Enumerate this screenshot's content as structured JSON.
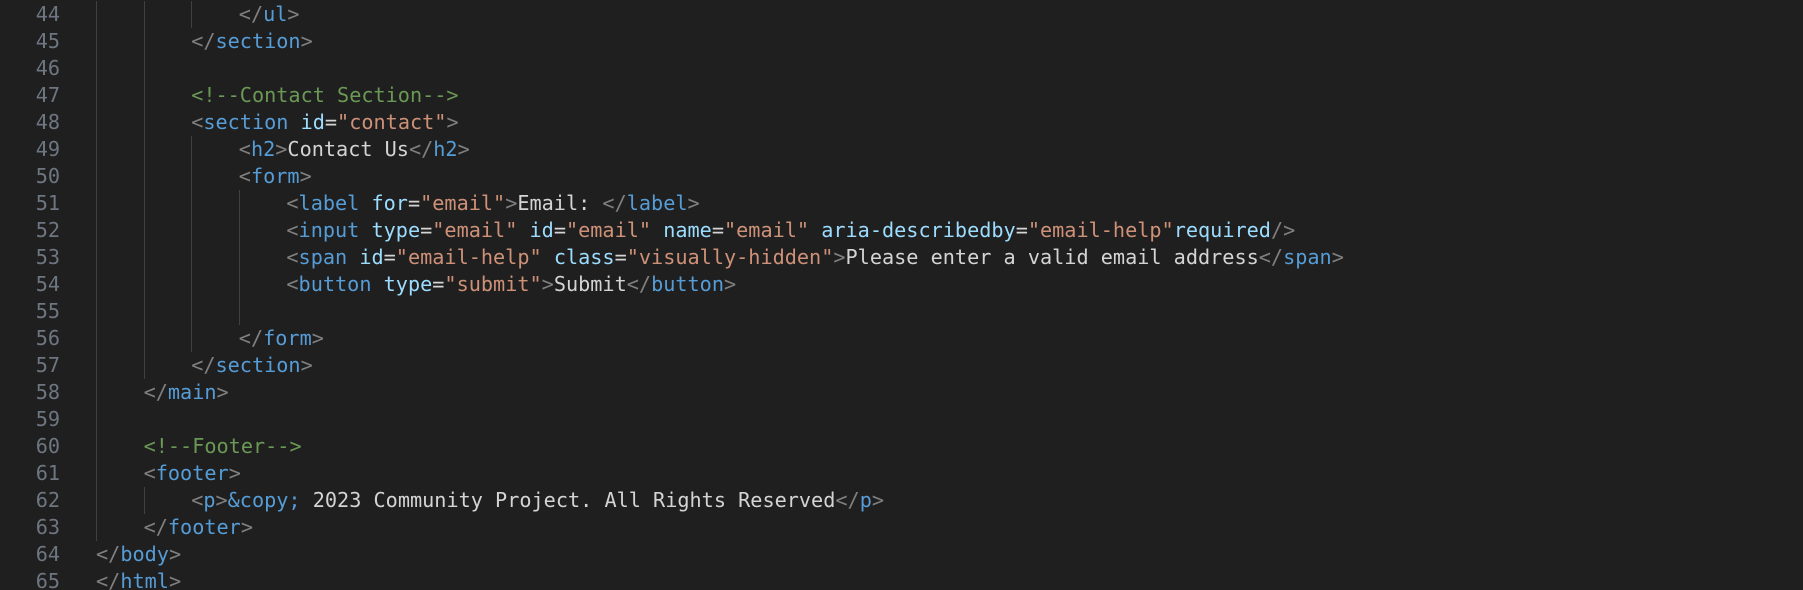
{
  "editor": {
    "language": "html",
    "colors": {
      "background": "#1f1f1f",
      "line_number": "#6e7681",
      "indent_guide": "#404040",
      "punctuation": "#808080",
      "tag": "#569cd6",
      "attribute": "#9cdcfe",
      "string": "#ce9178",
      "comment": "#6a9955",
      "entity": "#569cd6",
      "text": "#d4d4d4"
    },
    "lines": [
      {
        "n": "44",
        "indent": 4,
        "tokens": [
          [
            "punc",
            "</"
          ],
          [
            "tag",
            "ul"
          ],
          [
            "punc",
            ">"
          ]
        ]
      },
      {
        "n": "45",
        "indent": 3,
        "tokens": [
          [
            "punc",
            "</"
          ],
          [
            "tag",
            "section"
          ],
          [
            "punc",
            ">"
          ]
        ]
      },
      {
        "n": "46",
        "indent": 3,
        "tokens": []
      },
      {
        "n": "47",
        "indent": 3,
        "tokens": [
          [
            "com",
            "<!--Contact Section-->"
          ]
        ]
      },
      {
        "n": "48",
        "indent": 3,
        "tokens": [
          [
            "punc",
            "<"
          ],
          [
            "tag",
            "section"
          ],
          [
            "text",
            " "
          ],
          [
            "attr",
            "id"
          ],
          [
            "eq",
            "="
          ],
          [
            "str",
            "\"contact\""
          ],
          [
            "punc",
            ">"
          ]
        ]
      },
      {
        "n": "49",
        "indent": 4,
        "tokens": [
          [
            "punc",
            "<"
          ],
          [
            "tag",
            "h2"
          ],
          [
            "punc",
            ">"
          ],
          [
            "text",
            "Contact Us"
          ],
          [
            "punc",
            "</"
          ],
          [
            "tag",
            "h2"
          ],
          [
            "punc",
            ">"
          ]
        ]
      },
      {
        "n": "50",
        "indent": 4,
        "tokens": [
          [
            "punc",
            "<"
          ],
          [
            "tag",
            "form"
          ],
          [
            "punc",
            ">"
          ]
        ]
      },
      {
        "n": "51",
        "indent": 5,
        "tokens": [
          [
            "punc",
            "<"
          ],
          [
            "tag",
            "label"
          ],
          [
            "text",
            " "
          ],
          [
            "attr",
            "for"
          ],
          [
            "eq",
            "="
          ],
          [
            "str",
            "\"email\""
          ],
          [
            "punc",
            ">"
          ],
          [
            "text",
            "Email: "
          ],
          [
            "punc",
            "</"
          ],
          [
            "tag",
            "label"
          ],
          [
            "punc",
            ">"
          ]
        ]
      },
      {
        "n": "52",
        "indent": 5,
        "tokens": [
          [
            "punc",
            "<"
          ],
          [
            "tag",
            "input"
          ],
          [
            "text",
            " "
          ],
          [
            "attr",
            "type"
          ],
          [
            "eq",
            "="
          ],
          [
            "str",
            "\"email\""
          ],
          [
            "text",
            " "
          ],
          [
            "attr",
            "id"
          ],
          [
            "eq",
            "="
          ],
          [
            "str",
            "\"email\""
          ],
          [
            "text",
            " "
          ],
          [
            "attr",
            "name"
          ],
          [
            "eq",
            "="
          ],
          [
            "str",
            "\"email\""
          ],
          [
            "text",
            " "
          ],
          [
            "attr",
            "aria-describedby"
          ],
          [
            "eq",
            "="
          ],
          [
            "str",
            "\"email-help\""
          ],
          [
            "attr",
            "required"
          ],
          [
            "punc",
            "/>"
          ]
        ]
      },
      {
        "n": "53",
        "indent": 5,
        "tokens": [
          [
            "punc",
            "<"
          ],
          [
            "tag",
            "span"
          ],
          [
            "text",
            " "
          ],
          [
            "attr",
            "id"
          ],
          [
            "eq",
            "="
          ],
          [
            "str",
            "\"email-help\""
          ],
          [
            "text",
            " "
          ],
          [
            "attr",
            "class"
          ],
          [
            "eq",
            "="
          ],
          [
            "str",
            "\"visually-hidden\""
          ],
          [
            "punc",
            ">"
          ],
          [
            "text",
            "Please enter a valid email address"
          ],
          [
            "punc",
            "</"
          ],
          [
            "tag",
            "span"
          ],
          [
            "punc",
            ">"
          ]
        ]
      },
      {
        "n": "54",
        "indent": 5,
        "tokens": [
          [
            "punc",
            "<"
          ],
          [
            "tag",
            "button"
          ],
          [
            "text",
            " "
          ],
          [
            "attr",
            "type"
          ],
          [
            "eq",
            "="
          ],
          [
            "str",
            "\"submit\""
          ],
          [
            "punc",
            ">"
          ],
          [
            "text",
            "Submit"
          ],
          [
            "punc",
            "</"
          ],
          [
            "tag",
            "button"
          ],
          [
            "punc",
            ">"
          ]
        ]
      },
      {
        "n": "55",
        "indent": 5,
        "tokens": []
      },
      {
        "n": "56",
        "indent": 4,
        "tokens": [
          [
            "punc",
            "</"
          ],
          [
            "tag",
            "form"
          ],
          [
            "punc",
            ">"
          ]
        ]
      },
      {
        "n": "57",
        "indent": 3,
        "tokens": [
          [
            "punc",
            "</"
          ],
          [
            "tag",
            "section"
          ],
          [
            "punc",
            ">"
          ]
        ]
      },
      {
        "n": "58",
        "indent": 2,
        "tokens": [
          [
            "punc",
            "</"
          ],
          [
            "tag",
            "main"
          ],
          [
            "punc",
            ">"
          ]
        ]
      },
      {
        "n": "59",
        "indent": 2,
        "tokens": []
      },
      {
        "n": "60",
        "indent": 2,
        "tokens": [
          [
            "com",
            "<!--Footer-->"
          ]
        ]
      },
      {
        "n": "61",
        "indent": 2,
        "tokens": [
          [
            "punc",
            "<"
          ],
          [
            "tag",
            "footer"
          ],
          [
            "punc",
            ">"
          ]
        ]
      },
      {
        "n": "62",
        "indent": 3,
        "tokens": [
          [
            "punc",
            "<"
          ],
          [
            "tag",
            "p"
          ],
          [
            "punc",
            ">"
          ],
          [
            "ent",
            "&copy;"
          ],
          [
            "text",
            " 2023 Community Project. All Rights Reserved"
          ],
          [
            "punc",
            "</"
          ],
          [
            "tag",
            "p"
          ],
          [
            "punc",
            ">"
          ]
        ]
      },
      {
        "n": "63",
        "indent": 2,
        "tokens": [
          [
            "punc",
            "</"
          ],
          [
            "tag",
            "footer"
          ],
          [
            "punc",
            ">"
          ]
        ]
      },
      {
        "n": "64",
        "indent": 1,
        "tokens": [
          [
            "punc",
            "</"
          ],
          [
            "tag",
            "body"
          ],
          [
            "punc",
            ">"
          ]
        ]
      },
      {
        "n": "65",
        "indent": 1,
        "tokens": [
          [
            "punc",
            "</"
          ],
          [
            "tag",
            "html"
          ],
          [
            "punc",
            ">"
          ]
        ]
      }
    ]
  }
}
